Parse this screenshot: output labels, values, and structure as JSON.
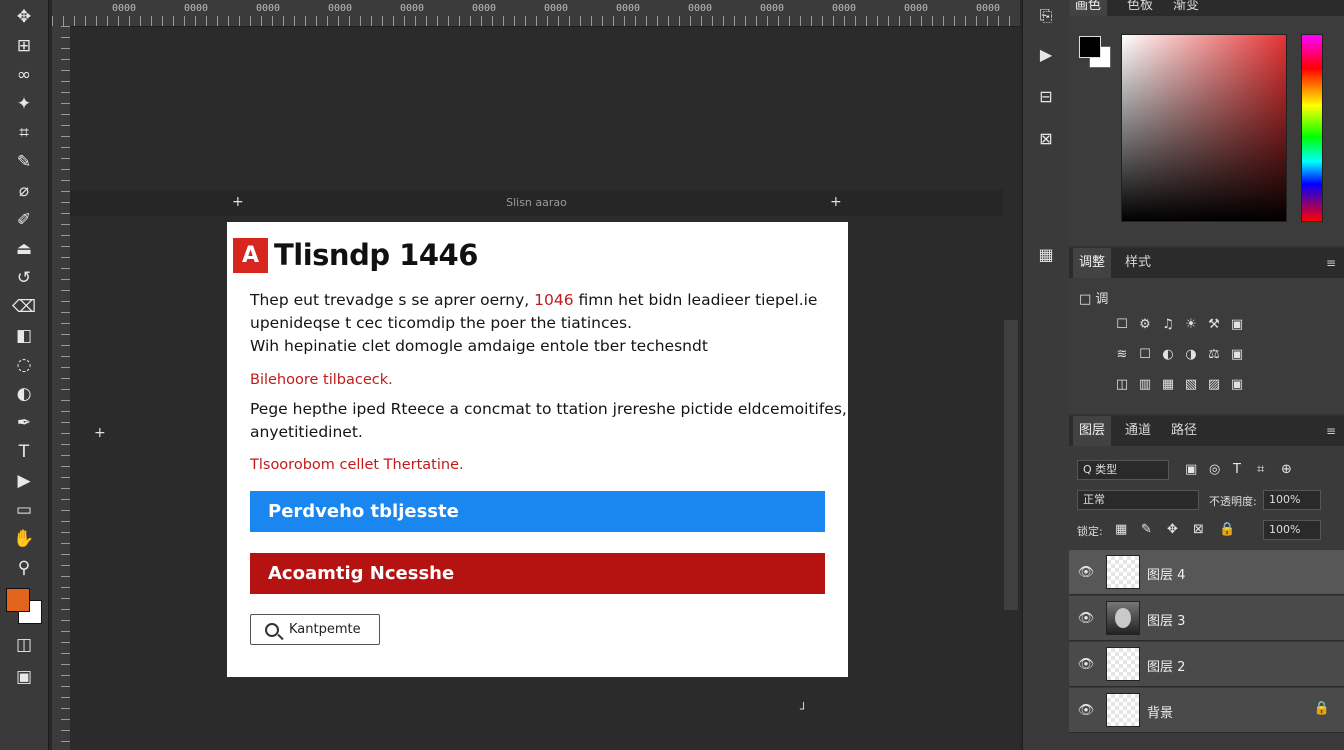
{
  "toolbar": {
    "tools": [
      {
        "name": "move-tool",
        "icon": "✥"
      },
      {
        "name": "artboard-tool",
        "icon": "⊞"
      },
      {
        "name": "lasso-tool",
        "icon": "∞"
      },
      {
        "name": "magic-wand-tool",
        "icon": "✦"
      },
      {
        "name": "crop-tool",
        "icon": "⌗"
      },
      {
        "name": "eyedropper-tool",
        "icon": "✎"
      },
      {
        "name": "healing-brush-tool",
        "icon": "⌀"
      },
      {
        "name": "brush-tool",
        "icon": "✐"
      },
      {
        "name": "clone-stamp-tool",
        "icon": "⏏"
      },
      {
        "name": "history-brush-tool",
        "icon": "↺"
      },
      {
        "name": "eraser-tool",
        "icon": "⌫"
      },
      {
        "name": "gradient-tool",
        "icon": "◧"
      },
      {
        "name": "blur-tool",
        "icon": "◌"
      },
      {
        "name": "dodge-tool",
        "icon": "◐"
      },
      {
        "name": "pen-tool",
        "icon": "✒"
      },
      {
        "name": "type-tool",
        "icon": "T"
      },
      {
        "name": "path-selection-tool",
        "icon": "▶"
      },
      {
        "name": "shape-tool",
        "icon": "▭"
      },
      {
        "name": "hand-tool",
        "icon": "✋"
      },
      {
        "name": "zoom-tool",
        "icon": "⚲"
      }
    ],
    "bottom_icons": [
      {
        "name": "quick-mask-icon",
        "icon": "◫"
      },
      {
        "name": "screen-mode-icon",
        "icon": "▣"
      }
    ],
    "foreground_color": "#e0641c",
    "background_color": "#ffffff"
  },
  "canvas": {
    "band_label": "Slisn aarao",
    "ruler_labels": [
      "0000",
      "0000",
      "0000",
      "0000",
      "0000",
      "0000",
      "0000",
      "0000",
      "0000",
      "0000",
      "0000",
      "0000",
      "0000",
      "0000"
    ]
  },
  "document": {
    "logo": "A",
    "title": "Tlisndp 1446",
    "para1_before": "Thep eut trevadge s se aprer oerny, ",
    "para1_number": "1046",
    "para1_after": " fimn het bidn leadieer tiepel.ie",
    "para1_line2": "upenideqse t cec ticomdip the poer the tiatinces.",
    "para1_line3": "Wih hepinatie clet domogle amdaige entole tber techesndt",
    "red1": "Bilehoore tilbaceck.",
    "para2_line1": "Pege hepthe iped Rteece a concmat to ttation jrereshe pictide eldcemoitifes,",
    "para2_line2": "anyetitiedinet.",
    "red2": "Tlsoorobom cellet Thertatine.",
    "button_blue": "Perdveho tbljesste",
    "button_red": "Acoamtig Ncesshe",
    "search_button": "Kantpemte",
    "accent_blue": "#1a86ef",
    "accent_red": "#b51212"
  },
  "icon_strip": [
    {
      "name": "history-panel-icon",
      "icon": "⎘"
    },
    {
      "name": "actions-panel-icon",
      "icon": "▶"
    },
    {
      "name": "properties-panel-icon",
      "icon": "⊟"
    },
    {
      "name": "adjustments-panel-icon",
      "icon": "⊠"
    },
    {
      "name": "libraries-panel-icon",
      "icon": "▦"
    }
  ],
  "panels": {
    "color": {
      "tab1": "画色",
      "tab2": "色板",
      "tab3": "渐变",
      "menu": "≡"
    },
    "adjustments": {
      "tab1": "调整",
      "tab2": "样式",
      "menu": "≡",
      "add_label": "□ 调",
      "icons": [
        "☐",
        "⚙",
        "♫",
        "☀",
        "⚒",
        "▣",
        "≋",
        "☐",
        "◐",
        "◑",
        "⚖",
        "▣",
        "◫",
        "▥",
        "▦",
        "▧",
        "▨",
        "▣"
      ]
    },
    "layers": {
      "tab1": "图层",
      "tab2": "通道",
      "tab3": "路径",
      "menu": "≡",
      "filter_kind": "Q 类型",
      "blend_mode": "正常",
      "opacity_label": "不透明度:",
      "opacity_value": "100%",
      "lock_label": "锁定:",
      "fill_value": "100%",
      "filter_icons": [
        "▣",
        "◎",
        "T",
        "⌗",
        "⊕"
      ],
      "lock_icons": [
        "▦",
        "✎",
        "✥",
        "⊠",
        "🔒"
      ],
      "items": [
        {
          "name": "图层 4",
          "thumb": "empty",
          "selected": true,
          "lock": ""
        },
        {
          "name": "图层 3",
          "thumb": "photo",
          "selected": false,
          "lock": ""
        },
        {
          "name": "图层 2",
          "thumb": "empty",
          "selected": false,
          "lock": ""
        },
        {
          "name": "背景",
          "thumb": "empty",
          "selected": false,
          "lock": "🔒"
        }
      ]
    }
  }
}
